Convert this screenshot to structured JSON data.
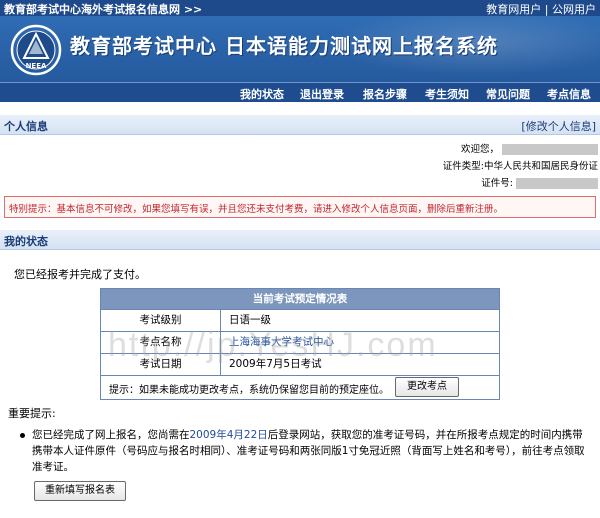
{
  "topbar": {
    "site_title": "教育部考试中心海外考试报名信息网  >>",
    "link_edu_user": "教育网用户",
    "separator": "|",
    "link_public_user": "公网用户"
  },
  "banner": {
    "logo_text": "NEEA",
    "title": "教育部考试中心   日本语能力测试网上报名系统"
  },
  "nav": {
    "items": [
      "我的状态",
      "退出登录",
      "报名步骤",
      "考生须知",
      "常见问题",
      "考点信息"
    ]
  },
  "personal": {
    "header": "个人信息",
    "edit_link": "[修改个人信息]",
    "welcome_label": "欢迎您，",
    "id_type_label": "证件类型:",
    "id_type_value": "中华人民共和国居民身份证",
    "id_number_label": "证件号:"
  },
  "warning": "特别提示：基本信息不可修改，如果您填写有误，并且您还未支付考费，请进入修改个人信息页面，删除后重新注册。",
  "status": {
    "header": "我的状态",
    "paid_message": "您已经报考并完成了支付。"
  },
  "booking_table": {
    "title": "当前考试预定情况表",
    "rows": [
      {
        "key": "考试级别",
        "value": "日语一级"
      },
      {
        "key": "考点名称",
        "value": "上海海事大学考试中心"
      },
      {
        "key": "考试日期",
        "value": "2009年7月5日考试"
      }
    ],
    "tip": "提示：如果未能成功更改考点，系统仍保留您目前的预定座位。",
    "change_button": "更改考点"
  },
  "important": {
    "header": "重要提示:",
    "text_before": "您已经完成了网上报名，您尚需在",
    "date_highlight": "2009年4月22日",
    "text_after": "后登录网站，获取您的准考证号码，并在所报考点规定的时间内携带携带本人证件原件（号码应与报名时相同）、准考证号码和两张同版1寸免冠近照（背面写上姓名和考号），前往考点领取准考证。",
    "refill_button": "重新填写报名表"
  },
  "watermark": "http://jp.YesHJ.com"
}
